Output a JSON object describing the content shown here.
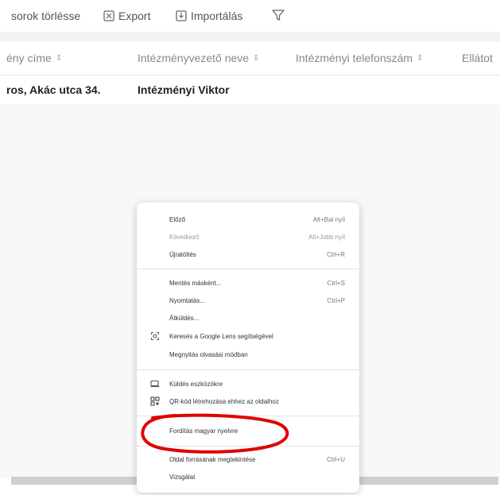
{
  "toolbar": {
    "delete_rows_label": "sorok törlésse",
    "export_label": "Export",
    "import_label": "Importálás"
  },
  "table": {
    "columns": [
      "ény címe",
      "Intézményvezető neve",
      "Intézményi telefonszám",
      "Ellátot"
    ],
    "row": [
      "ros, Akác utca 34.",
      "Intézményi Viktor",
      "",
      ""
    ]
  },
  "context_menu": {
    "items": [
      {
        "label": "Előző",
        "shortcut": "Alt+Bal nyíl"
      },
      {
        "label": "Következő",
        "shortcut": "Alt+Jobb nyíl"
      },
      {
        "label": "Újratöltés",
        "shortcut": "Ctrl+R"
      },
      {
        "label": "Mentés másként...",
        "shortcut": "Ctrl+S"
      },
      {
        "label": "Nyomtatás...",
        "shortcut": "Ctrl+P"
      },
      {
        "label": "Átküldés..."
      },
      {
        "label": "Keresés a Google Lens segítségével",
        "icon": "google-lens-icon"
      },
      {
        "label": "Megnyitás olvasási módban"
      },
      {
        "label": "Küldés eszközökre",
        "icon": "send-to-devices-icon"
      },
      {
        "label": "QR-kód létrehozása ehhez az oldalhoz",
        "icon": "qr-code-icon"
      },
      {
        "label": "Fordítás magyar nyelvre"
      },
      {
        "label": "Oldal forrásának megtekintése",
        "shortcut": "Ctrl+U"
      },
      {
        "label": "Vizsgálat"
      }
    ]
  },
  "annotation": {
    "color": "#e00000"
  }
}
